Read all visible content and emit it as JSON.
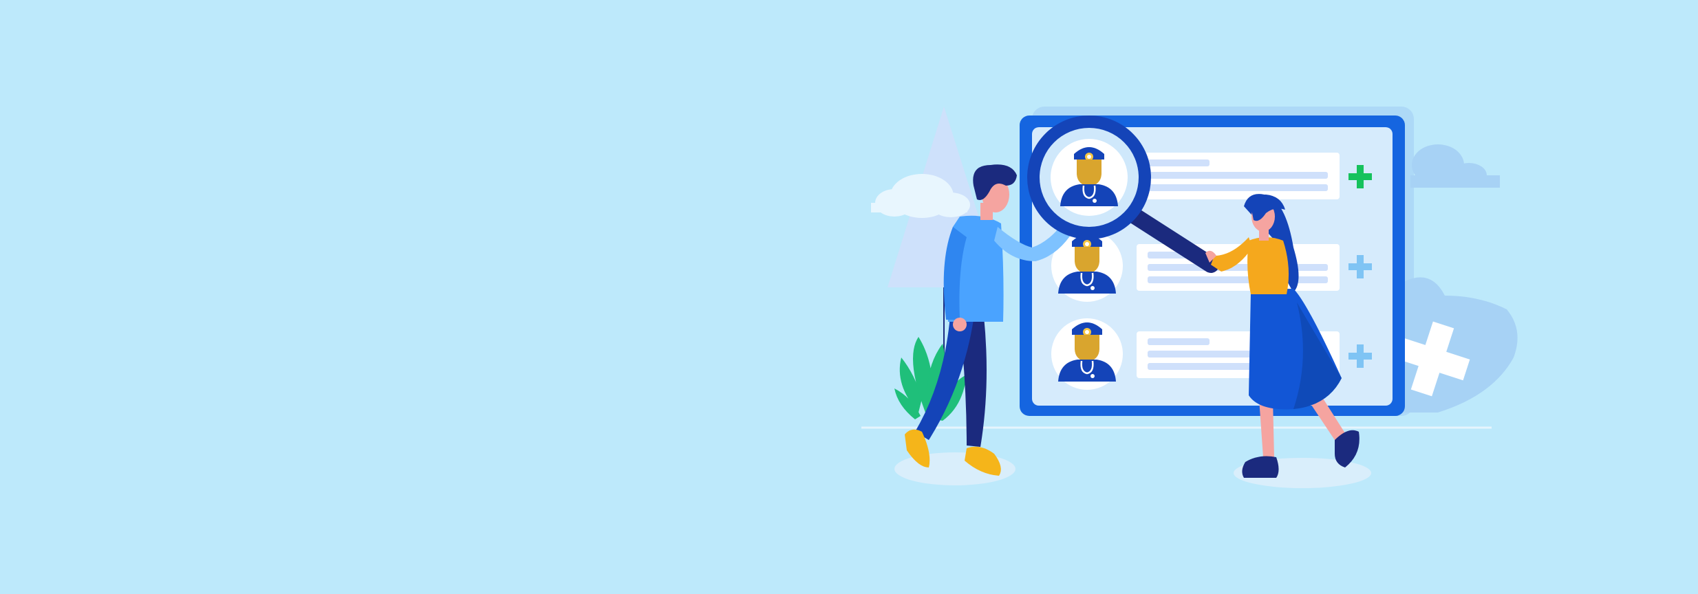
{
  "scene": {
    "background_color": "#bde9fb",
    "illustration": "two-people-searching-doctor-directory-with-magnifying-glass",
    "doctor_cards": [
      {
        "id": 1,
        "action_icon": "plus-icon",
        "action_color": "#16c25c",
        "highlighted": true
      },
      {
        "id": 2,
        "action_icon": "plus-icon",
        "action_color": "#7fc4f4",
        "highlighted": false
      },
      {
        "id": 3,
        "action_icon": "plus-icon",
        "action_color": "#7fc4f4",
        "highlighted": false
      }
    ],
    "colors": {
      "board_frame": "#1565e0",
      "board_panel": "#d6ebfc",
      "magnifier": "#1444b8",
      "doctor_skin": "#d9a52e",
      "doctor_uniform": "#1444b8",
      "man_shirt": "#4aa3ff",
      "man_pants": "#1b2a7e",
      "woman_top": "#f5a81d",
      "woman_skirt": "#1256d6",
      "shoes_yellow": "#f5b51a",
      "plant": "#1fbf7a"
    }
  }
}
